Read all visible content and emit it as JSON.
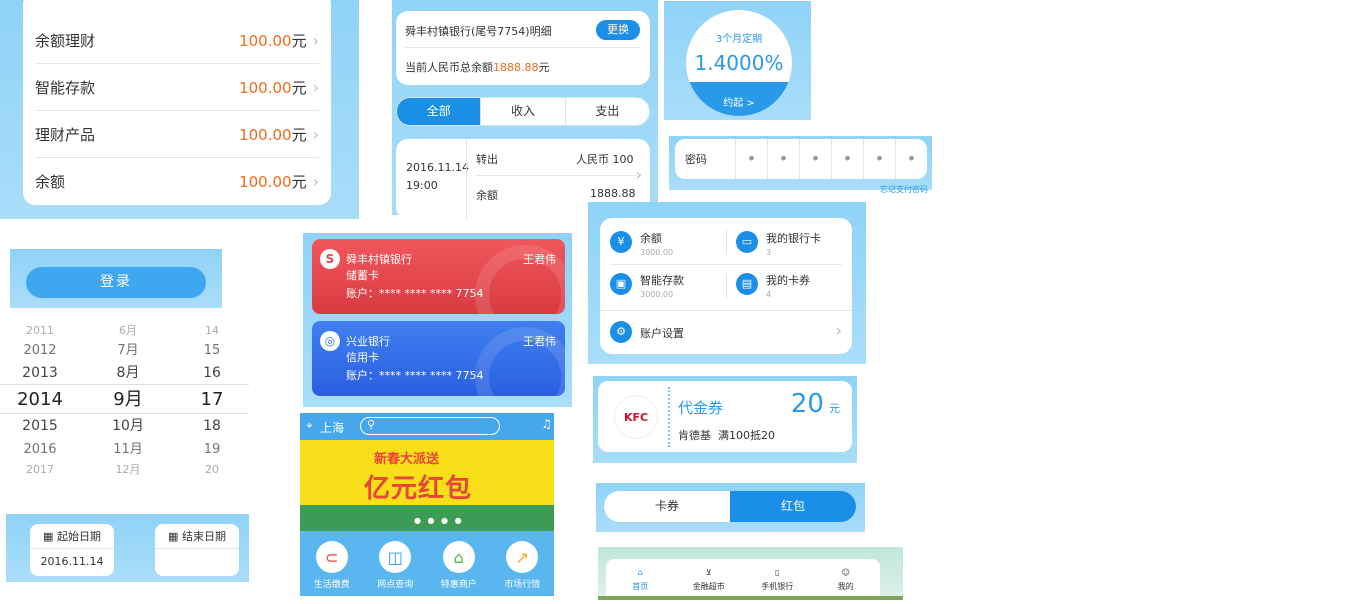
{
  "wealth_list": {
    "items": [
      {
        "label": "余额理财",
        "amount": "100.00",
        "unit": "元"
      },
      {
        "label": "智能存款",
        "amount": "100.00",
        "unit": "元"
      },
      {
        "label": "理财产品",
        "amount": "100.00",
        "unit": "元"
      },
      {
        "label": "余额",
        "amount": "100.00",
        "unit": "元"
      }
    ]
  },
  "statement": {
    "title": "舜丰村镇银行(尾号7754)明细",
    "change_label": "更换",
    "balance_prefix": "当前人民币总余额",
    "balance_value": "1888.88",
    "balance_unit": "元",
    "tabs": [
      "全部",
      "收入",
      "支出"
    ],
    "record": {
      "date": "2016.11.14",
      "time": "19:00",
      "type": "转出",
      "amount_label": "人民币 100",
      "balance_label": "余额",
      "balance_value": "1888.88"
    }
  },
  "fixed_deposit": {
    "term": "3个月定期",
    "rate": "1.4000%",
    "action": "约起 >"
  },
  "password": {
    "label": "密码",
    "dots": [
      "•",
      "•",
      "•",
      "•",
      "•",
      "•"
    ],
    "forgot": "忘记支付密码"
  },
  "login": {
    "button_label": "登录"
  },
  "date_picker": {
    "years": [
      "2011",
      "2012",
      "2013",
      "2014",
      "2015",
      "2016",
      "2017"
    ],
    "months": [
      "6月",
      "7月",
      "8月",
      "9月",
      "10月",
      "11月",
      "12月"
    ],
    "days": [
      "14",
      "15",
      "16",
      "17",
      "18",
      "19",
      "20"
    ]
  },
  "date_range": {
    "start_label": "起始日期",
    "start_value": "2016.11.14",
    "end_label": "结束日期",
    "end_value": ""
  },
  "bank_cards": [
    {
      "bank": "舜丰村镇银行",
      "type": "储蓄卡",
      "holder": "王君伟",
      "account": "账户：**** **** **** 7754",
      "color": "#e8434a"
    },
    {
      "bank": "兴业银行",
      "type": "信用卡",
      "holder": "王君伟",
      "account": "账户：**** **** **** 7754",
      "color": "#2f6fe8"
    }
  ],
  "home": {
    "city": "上海",
    "banner_line1": "新春大派送",
    "banner_line2": "亿元红包",
    "shortcuts": [
      {
        "label": "生活缴费",
        "icon": "bill-icon",
        "color": "#e8443a"
      },
      {
        "label": "网点查询",
        "icon": "map-icon",
        "color": "#2a9ae8"
      },
      {
        "label": "特惠商户",
        "icon": "shop-icon",
        "color": "#4cb84a"
      },
      {
        "label": "市场行情",
        "icon": "chart-icon",
        "color": "#f2a51b"
      }
    ]
  },
  "account_menu": {
    "items": [
      {
        "label": "余额",
        "sub": "3000.00",
        "icon": "yuan-icon"
      },
      {
        "label": "我的银行卡",
        "sub": "3",
        "icon": "card-icon"
      },
      {
        "label": "智能存款",
        "sub": "3000.00",
        "icon": "deposit-icon"
      },
      {
        "label": "我的卡券",
        "sub": "4",
        "icon": "coupon-icon"
      }
    ],
    "settings_label": "账户设置"
  },
  "coupon": {
    "title": "代金券",
    "value": "20",
    "unit": "元",
    "merchant": "肯德基",
    "desc": "满100抵20",
    "logo_text": "KFC"
  },
  "coupon_tabs": [
    "卡券",
    "红包"
  ],
  "tab_bar": [
    "首页",
    "金融超市",
    "手机银行",
    "我的"
  ]
}
